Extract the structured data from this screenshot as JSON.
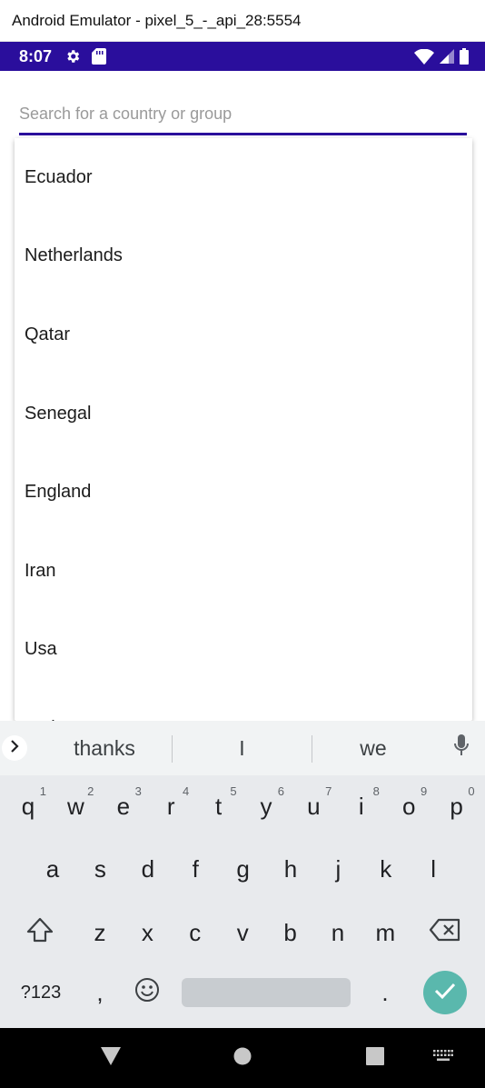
{
  "window": {
    "title": "Android Emulator - pixel_5_-_api_28:5554"
  },
  "status_bar": {
    "time": "8:07",
    "color": "#2a0e9c"
  },
  "search": {
    "placeholder": "Search for a country or group",
    "value": ""
  },
  "dropdown": {
    "items": [
      "Ecuador",
      "Netherlands",
      "Qatar",
      "Senegal",
      "England",
      "Iran",
      "Usa",
      "Wales"
    ]
  },
  "keyboard": {
    "suggestions": [
      "thanks",
      "I",
      "we"
    ],
    "row1": [
      {
        "key": "q",
        "hint": "1"
      },
      {
        "key": "w",
        "hint": "2"
      },
      {
        "key": "e",
        "hint": "3"
      },
      {
        "key": "r",
        "hint": "4"
      },
      {
        "key": "t",
        "hint": "5"
      },
      {
        "key": "y",
        "hint": "6"
      },
      {
        "key": "u",
        "hint": "7"
      },
      {
        "key": "i",
        "hint": "8"
      },
      {
        "key": "o",
        "hint": "9"
      },
      {
        "key": "p",
        "hint": "0"
      }
    ],
    "row2": [
      "a",
      "s",
      "d",
      "f",
      "g",
      "h",
      "j",
      "k",
      "l"
    ],
    "row3": [
      "z",
      "x",
      "c",
      "v",
      "b",
      "n",
      "m"
    ],
    "symbols_label": "?123",
    "comma": ",",
    "period": ".",
    "enter_color": "#5ab8ad"
  }
}
